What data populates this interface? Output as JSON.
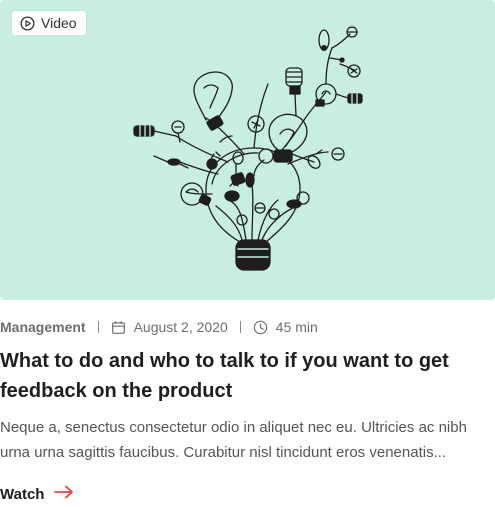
{
  "colors": {
    "thumbnail_bg": "#c8eee1",
    "accent_arrow": "#e8473c"
  },
  "thumbnail": {
    "badge_label": "Video",
    "badge_icon": "play-circle-icon",
    "illustration": "hand-drawn-light-bulbs"
  },
  "meta": {
    "category": "Management",
    "date_icon": "calendar-icon",
    "date": "August 2, 2020",
    "duration_icon": "clock-icon",
    "duration": "45 min"
  },
  "title": "What to do and who to talk to if you want to get feedback on the product",
  "description": "Neque a, senectus consectetur odio in aliquet nec eu. Ultricies ac nibh urna urna sagittis faucibus. Curabitur nisl tincidunt eros venenatis...",
  "cta": {
    "label": "Watch",
    "icon": "arrow-right-icon"
  }
}
